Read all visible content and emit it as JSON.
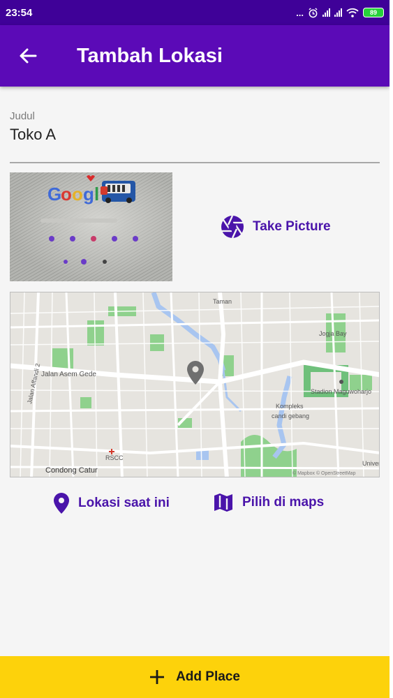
{
  "status_bar": {
    "time": "23:54",
    "dots": "...",
    "battery": "89"
  },
  "app_bar": {
    "title": "Tambah Lokasi",
    "back_icon": "arrow-left-icon"
  },
  "form": {
    "title_field": {
      "label": "Judul",
      "value": "Toko A"
    }
  },
  "photo": {
    "logo_text": "Googl"
  },
  "take_picture": {
    "label": "Take Picture",
    "icon": "camera-shutter-icon"
  },
  "map": {
    "labels": {
      "taman": "Taman",
      "jogja_bay": "Jogja Bay",
      "jalan_affandi": "Jalan Affandi 2",
      "jalan_asem": "Jalan Asem Gede",
      "stadion": "Stadion Maguwoharjo",
      "komplek": "Kompleks",
      "candi": "candi gebang",
      "rscc": "RSCC",
      "condong": "Condong Catur",
      "attribution": "© Mapbox © OpenStreetMap",
      "univ": "Univer"
    },
    "marker_icon": "map-marker-icon",
    "accent_colors": {
      "park": "#8fd18d",
      "water": "#a8c5f0",
      "road": "#ffffff"
    }
  },
  "actions": {
    "current_location": {
      "label": "Lokasi saat ini",
      "icon": "location-pin-icon"
    },
    "pick_on_map": {
      "label": "Pilih di maps",
      "icon": "map-icon"
    }
  },
  "bottom": {
    "add_place_label": "Add Place",
    "add_icon": "plus-icon"
  },
  "colors": {
    "status_bar": "#3f0198",
    "app_bar": "#5b0ab7",
    "accent": "#4a14aa",
    "add_button": "#fdd20b"
  }
}
